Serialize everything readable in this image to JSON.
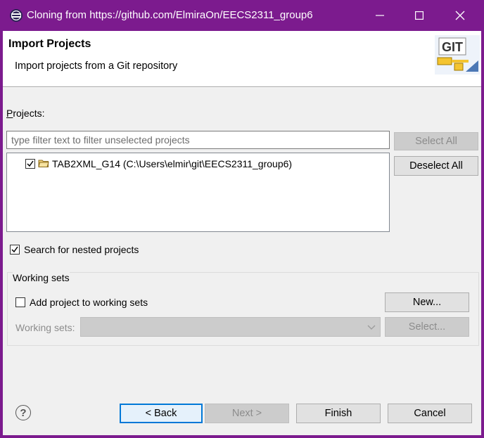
{
  "window": {
    "title": "Cloning from https://github.com/ElmiraOn/EECS2311_group6",
    "accent": "#7c1b8e"
  },
  "banner": {
    "title": "Import Projects",
    "description": "Import projects from a Git repository",
    "logo_text": "GIT"
  },
  "projects": {
    "label": "Projects:",
    "filter_placeholder": "type filter text to filter unselected projects",
    "items": [
      {
        "label": "TAB2XML_G14 (C:\\Users\\elmir\\git\\EECS2311_group6)",
        "checked": true,
        "icon": "folder-icon"
      }
    ],
    "select_all": "Select All",
    "deselect_all": "Deselect All"
  },
  "nested": {
    "label": "Search for nested projects",
    "checked": true
  },
  "working_sets": {
    "title": "Working sets",
    "add_label": "Add project to working sets",
    "add_checked": false,
    "new_button": "New...",
    "field_label": "Working sets:",
    "selected_value": "",
    "select_button": "Select..."
  },
  "footer": {
    "back": "< Back",
    "next": "Next >",
    "finish": "Finish",
    "cancel": "Cancel"
  }
}
